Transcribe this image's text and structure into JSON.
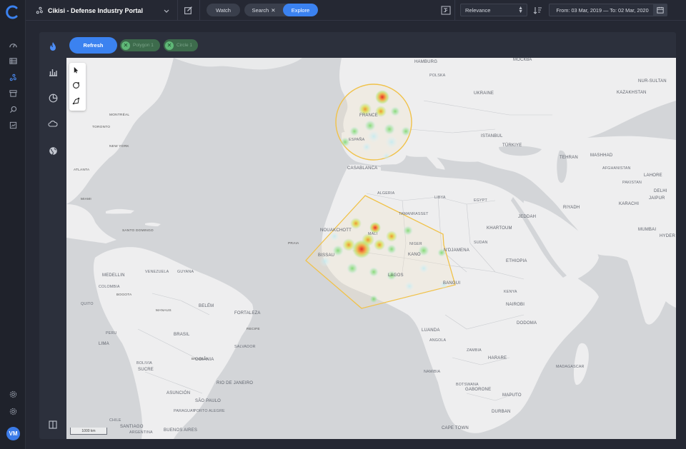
{
  "app": {
    "title": "Cikisi - Defense Industry Portal",
    "user_initials": "VM",
    "accent_color": "#3b82f0"
  },
  "topbar": {
    "watch_label": "Watch",
    "search_label": "Search",
    "explore_label": "Explore",
    "sort_select": {
      "selected": "Relevance"
    },
    "date_range": "From: 03 Mar, 2019  —  To: 02 Mar, 2020"
  },
  "sidebar": {
    "items": [
      {
        "icon": "dashboard-icon"
      },
      {
        "icon": "list-icon"
      },
      {
        "icon": "explore-icon",
        "active": true
      },
      {
        "icon": "archive-icon"
      },
      {
        "icon": "search-icon"
      },
      {
        "icon": "report-icon"
      },
      {
        "icon": "settings-icon"
      },
      {
        "icon": "gear-icon"
      }
    ]
  },
  "panel": {
    "tools": [
      {
        "icon": "flame-icon",
        "active": true
      },
      {
        "icon": "bar-chart-icon"
      },
      {
        "icon": "pie-chart-icon"
      },
      {
        "icon": "cloud-icon"
      },
      {
        "icon": "globe-icon"
      },
      {
        "icon": "split-panel-icon"
      }
    ],
    "refresh_label": "Refresh",
    "filters": [
      {
        "label": "Polygon 1"
      },
      {
        "label": "Circle 1"
      }
    ],
    "map_tools": [
      {
        "icon": "pointer-icon"
      },
      {
        "icon": "circle-draw-icon"
      },
      {
        "icon": "polygon-draw-icon"
      }
    ],
    "scale_label": "1000 km"
  },
  "map": {
    "labels": {
      "hamburg": "HAMBURG",
      "moskva": "МОСКВА",
      "ukraine": "UKRAINE",
      "kazakhstan": "KAZAKHSTAN",
      "nur_sultan": "NUR-SULTAN",
      "poland": "POLSKA",
      "france": "FRANCE",
      "espana": "ESPAÑA",
      "istanbul": "ISTANBUL",
      "turkiye": "TÜRKIYE",
      "tehran": "TEHRAN",
      "mashhad": "MASHHAD",
      "afghanistan": "AFGHANISTAN",
      "lahore": "LAHORE",
      "delhi": "DELHI",
      "jaipur": "JAIPUR",
      "karachi": "KARACHI",
      "pakistan": "PAKISTAN",
      "mumbai": "MUMBAI",
      "hyderabad": "HYDER",
      "casablanca": "CASABLANCA",
      "algeria": "ALGERIA",
      "libya": "LIBYA",
      "egypt": "EGYPT",
      "riyadh": "RIYADH",
      "jeddah": "JEDDAH",
      "mali": "MALI",
      "tamanrasset": "TAMANRASSET",
      "nouakchott": "NOUAKCHOTT",
      "niger": "NIGER",
      "bissau": "BISSAU",
      "kano": "KANO",
      "ndjamena": "N'DJAMENA",
      "sudan": "SUDAN",
      "khartoum": "KHARTOUM",
      "ethiopia": "ETHIOPIA",
      "lagos": "LAGOS",
      "bangui": "BANGUI",
      "nairobi": "NAIROBI",
      "kenya": "KENYA",
      "dodoma": "DODOMA",
      "luanda": "LUANDA",
      "angola": "ANGOLA",
      "zambia": "ZAMBIA",
      "harare": "HARARE",
      "namibia": "NAMIBIA",
      "botswana": "BOTSWANA",
      "gaborone": "GABORONE",
      "durban": "DURBAN",
      "cape_town": "CAPE TOWN",
      "maputo": "MAPUTO",
      "madagascar": "MADAGASCAR",
      "montreal": "MONTRÉAL",
      "toronto": "TORONTO",
      "new_york": "NEW YORK",
      "atlanta": "ATLANTA",
      "miami": "MIAMI",
      "santo_domingo": "SANTO DOMINGO",
      "medellin": "MEDELLIN",
      "colombia": "COLOMBIA",
      "bogota": "BOGOTA",
      "quito": "QUITO",
      "lima": "LIMA",
      "peru": "PERU",
      "brasil": "BRASIL",
      "manaus": "MANAUS",
      "belem": "BELÉM",
      "fortaleza": "FORTALEZA",
      "recife": "RECIFE",
      "salvador": "SALVADOR",
      "brasilia": "BRASILIA",
      "goiania": "GOIÂNIA",
      "bolivia": "BOLIVIA",
      "sucre": "SUCRE",
      "asuncion": "ASUNCIÓN",
      "sao_paulo": "SÃO PAULO",
      "rio": "RIO DE JANEIRO",
      "porto_alegre": "PORTO ALEGRE",
      "santiago": "SANTIAGO",
      "buenos_aires": "BUENOS AIRES",
      "argentina": "ARGENTINA",
      "chile": "CHILE",
      "paraguay": "PARAGUAY",
      "praia": "PRAIA",
      "guyana": "GUYANA",
      "venezuela": "VENEZUELA"
    }
  }
}
